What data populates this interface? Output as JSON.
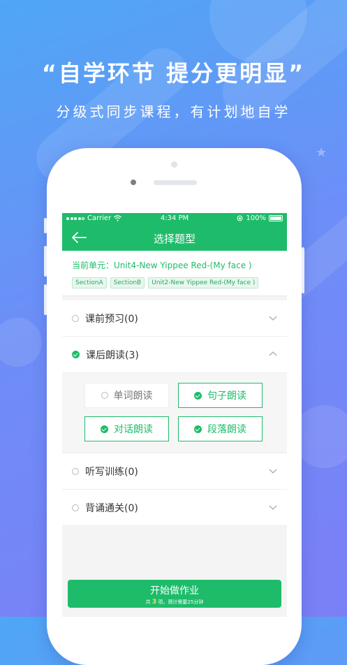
{
  "promo": {
    "headline": "“自学环节  提分更明显”",
    "subline": "分级式同步课程，有计划地自学"
  },
  "statusbar": {
    "carrier": "Carrier",
    "time": "4:34 PM",
    "battery": "100%"
  },
  "nav": {
    "title": "选择题型",
    "back_icon": "arrow-left-icon"
  },
  "unit": {
    "label": "当前单元：Unit4-New Yippee Red-(My face )",
    "tags": [
      "SectionA",
      "SectionB",
      "Unit2-New Yippee Red-(My face )"
    ]
  },
  "categories": [
    {
      "label": "课前预习(0)",
      "checked": false,
      "expanded": false
    },
    {
      "label": "课后朗读(3)",
      "checked": true,
      "expanded": true
    },
    {
      "label": "听写训练(0)",
      "checked": false,
      "expanded": false
    },
    {
      "label": "背诵通关(0)",
      "checked": false,
      "expanded": false
    }
  ],
  "read_options": [
    {
      "label": "单词朗读",
      "checked": false
    },
    {
      "label": "句子朗读",
      "checked": true
    },
    {
      "label": "对话朗读",
      "checked": true
    },
    {
      "label": "段落朗读",
      "checked": true
    }
  ],
  "start": {
    "title": "开始做作业",
    "sub_prefix": "共",
    "count": "3",
    "sub_suffix": "项，预计需要25分钟"
  },
  "colors": {
    "brand_green": "#1ebc6a",
    "bg_blue": "#5d98f7"
  }
}
